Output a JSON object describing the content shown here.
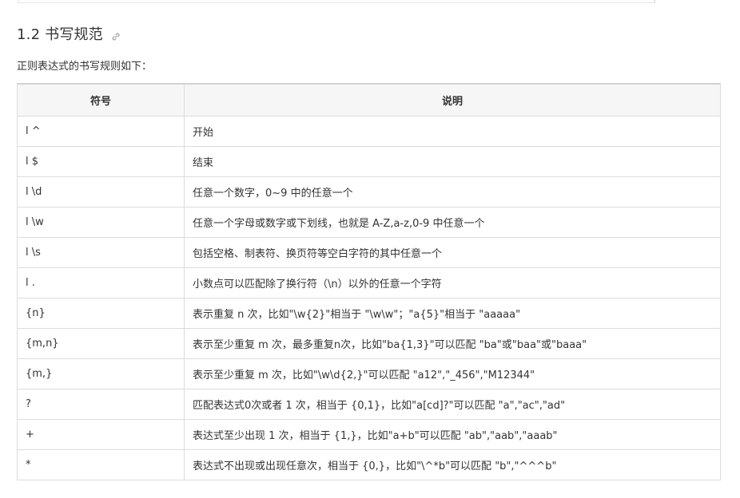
{
  "section": {
    "title": "1.2 书写规范",
    "anchor_icon": "link-icon"
  },
  "intro": "正则表达式的书写规则如下：",
  "table": {
    "headers": [
      "符号",
      "说明"
    ],
    "rows": [
      [
        "l ^",
        "开始"
      ],
      [
        "l $",
        "结束"
      ],
      [
        "l \\d",
        "任意一个数字，0~9 中的任意一个"
      ],
      [
        "l \\w",
        "任意一个字母或数字或下划线，也就是 A-Z,a-z,0-9 中任意一个"
      ],
      [
        "l \\s",
        "包括空格、制表符、换页符等空白字符的其中任意一个"
      ],
      [
        "l .",
        "小数点可以匹配除了换行符（\\n）以外的任意一个字符"
      ],
      [
        "{n}",
        "表示重复 n 次，比如\"\\w{2}\"相当于 \"\\w\\w\"；\"a{5}\"相当于 \"aaaaa\""
      ],
      [
        "{m,n}",
        "表示至少重复 m 次，最多重复n次，比如\"ba{1,3}\"可以匹配 \"ba\"或\"baa\"或\"baaa\""
      ],
      [
        "{m,}",
        "表示至少重复 m 次，比如\"\\w\\d{2,}\"可以匹配 \"a12\",\"_456\",\"M12344\""
      ],
      [
        "?",
        "匹配表达式0次或者 1 次，相当于 {0,1}，比如\"a[cd]?\"可以匹配 \"a\",\"ac\",\"ad\""
      ],
      [
        "+",
        "表达式至少出现 1 次，相当于 {1,}，比如\"a+b\"可以匹配 \"ab\",\"aab\",\"aaab\""
      ],
      [
        "*",
        "表达式不出现或出现任意次，相当于 {0,}，比如\"\\^*b\"可以匹配 \"b\",\"^^^b\""
      ]
    ]
  }
}
